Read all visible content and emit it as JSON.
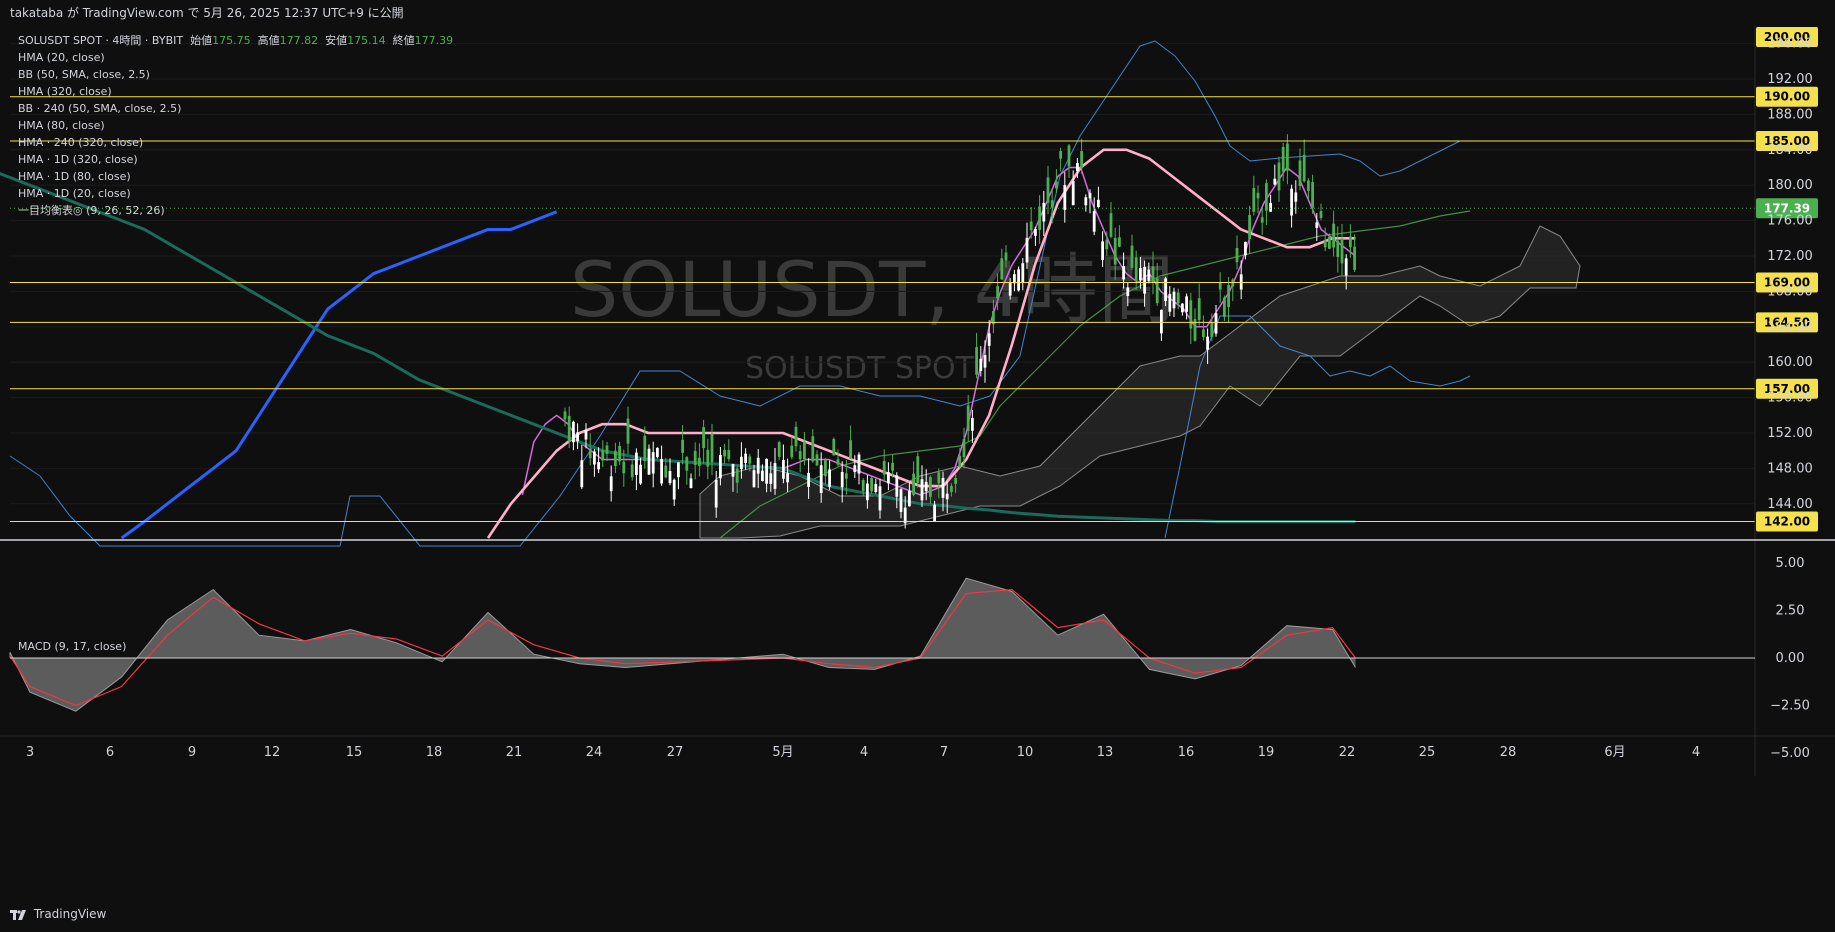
{
  "header": {
    "text": "takataba が TradingView.com で 5月 26, 2025 12:37 UTC+9 に公開"
  },
  "legend": {
    "symbol": "SOLUSDT SPOT · 4時間 · BYBIT",
    "open_label": "始値",
    "open": "175.75",
    "high_label": "高値",
    "high": "177.82",
    "low_label": "安値",
    "low": "175.14",
    "close_label": "終値",
    "close": "177.39",
    "indicators": [
      "HMA (20, close)",
      "BB (50, SMA, close, 2.5)",
      "HMA (320, close)",
      "BB · 240 (50, SMA, close, 2.5)",
      "HMA (80, close)",
      "HMA · 240 (320, close)",
      "HMA · 1D (320, close)",
      "HMA · 1D (80, close)",
      "HMA · 1D (20, close)",
      "一目均衡表◎ (9, 26, 52, 26)"
    ]
  },
  "watermark": {
    "main": "SOLUSDT, 4時間",
    "sub": "SOLUSDT SPOT"
  },
  "macd_label": "MACD (9, 17, close)",
  "footer": {
    "brand": "TradingView"
  },
  "colors": {
    "up": "#4caf50",
    "down": "#ffffff",
    "level": "#f5e14b",
    "bb": "#4a90e2",
    "hma20": "#d36be0",
    "hma80": "#ffb0c8",
    "hma320": "#2962ff",
    "hma_green": "#4caf50",
    "long_teal": "#1b6b5a",
    "cloud": "#808080",
    "macd_signal": "#f23645",
    "price_tag": "#4caf50"
  },
  "chart_data": [
    {
      "type": "line",
      "title": "SOLUSDT SPOT · 4時間 · BYBIT",
      "ylim": [
        140,
        200
      ],
      "x_ticks": [
        "3",
        "6",
        "9",
        "12",
        "15",
        "18",
        "21",
        "24",
        "27",
        "5月",
        "4",
        "7",
        "10",
        "13",
        "16",
        "19",
        "22",
        "25",
        "28",
        "6月",
        "4"
      ],
      "y_ticks": [
        "144.00",
        "148.00",
        "152.00",
        "156.00",
        "160.00",
        "164.00",
        "168.00",
        "172.00",
        "176.00",
        "180.00",
        "184.00",
        "188.00",
        "192.00",
        "196.00"
      ],
      "horizontal_levels": [
        200.0,
        190.0,
        185.0,
        169.0,
        164.5,
        157.0,
        142.0
      ],
      "level_labels": [
        "200.00",
        "190.00",
        "185.00",
        "169.00",
        "164.50",
        "157.00",
        "142.00"
      ],
      "last_price": 177.39,
      "last_price_label": "177.39",
      "series": [
        {
          "name": "HMA (20, close)",
          "x": [
            24.5,
            25,
            25.5,
            26,
            26.5,
            27,
            27.5,
            28,
            29,
            30,
            1,
            2,
            3,
            4,
            5,
            6,
            7,
            8,
            8.5,
            9,
            9.5,
            10,
            10.5,
            11,
            11.5,
            12,
            12.5,
            13,
            13.5,
            14,
            14.5,
            15,
            15.5,
            16,
            16.5,
            17,
            17.5,
            18,
            18.5,
            19,
            19.5,
            20,
            20.5,
            21,
            21.5,
            22,
            22.5,
            23,
            23.5,
            24,
            24.5,
            25,
            25.5,
            26
          ],
          "values": [
            145,
            151,
            153,
            154,
            153,
            151,
            150,
            149,
            149,
            149,
            148,
            149,
            149,
            148,
            147,
            146,
            145,
            146,
            148,
            152,
            158,
            164,
            168,
            171,
            173,
            175,
            178,
            181,
            182,
            182,
            178,
            175,
            172,
            170,
            169,
            170,
            168,
            167,
            166,
            164,
            164,
            166,
            168,
            171,
            175,
            178,
            180,
            182,
            181,
            178,
            175,
            174,
            173,
            172
          ]
        },
        {
          "name": "HMA (80, close)",
          "x": [
            23,
            24,
            25,
            26,
            27,
            28,
            29,
            30,
            1,
            2,
            3,
            4,
            5,
            6,
            7,
            8,
            9,
            10,
            11,
            12,
            13,
            14,
            15,
            16,
            17,
            18,
            19,
            20,
            21,
            22,
            23,
            24,
            25,
            26
          ],
          "values": [
            140,
            144,
            147,
            150,
            152,
            153,
            153,
            152,
            152,
            151,
            150,
            149,
            148,
            147,
            146,
            146,
            149,
            154,
            162,
            171,
            178,
            182,
            184,
            184,
            183,
            181,
            179,
            177,
            175,
            174,
            173,
            173,
            174,
            174
          ]
        },
        {
          "name": "HMA (320, close)",
          "x": [
            7,
            8,
            9,
            10,
            11,
            12,
            13,
            14,
            15,
            16,
            17,
            18,
            19,
            20,
            21,
            22,
            23,
            24,
            25,
            26
          ],
          "values": [
            140,
            142,
            144,
            146,
            148,
            150,
            154,
            158,
            162,
            166,
            168,
            170,
            171,
            172,
            173,
            174,
            175,
            175,
            176,
            177
          ]
        },
        {
          "name": "HMA · 240 (320, close)",
          "x": [
            -2,
            0,
            2,
            4,
            6,
            8,
            10,
            12,
            14,
            16,
            18,
            20,
            22,
            24,
            26,
            28,
            30,
            1,
            2,
            3,
            4,
            5,
            6,
            7,
            8,
            9,
            10,
            11,
            12,
            13,
            14,
            15,
            16,
            17,
            18,
            19,
            20,
            21,
            22,
            23,
            24,
            25,
            26
          ],
          "values": [
            185,
            183,
            181,
            179,
            177,
            175,
            172,
            169,
            166,
            163,
            161,
            158,
            156,
            154,
            152,
            150,
            149,
            148,
            147,
            146,
            145.5,
            145,
            144.5,
            144,
            143.8,
            143.5,
            143.3,
            143,
            142.8,
            142.6,
            142.5,
            142.4,
            142.3,
            142.2,
            142.1,
            142.1,
            142,
            142,
            142,
            142,
            142,
            142,
            142
          ]
        },
        {
          "name": "MACD",
          "x": [
            -1,
            1,
            3,
            5,
            7,
            9,
            11,
            13,
            15,
            17,
            19,
            21,
            23,
            25,
            27,
            29,
            1,
            3,
            5,
            7,
            9,
            11,
            13,
            15,
            17,
            19,
            21,
            23,
            25,
            26
          ],
          "values": [
            0,
            0.3,
            -1.8,
            -2.8,
            -1,
            2,
            3.6,
            1.2,
            0.9,
            1.5,
            0.8,
            -0.2,
            2.4,
            0.2,
            -0.3,
            -0.5,
            0.2,
            -0.5,
            -0.6,
            0.1,
            4.2,
            3.5,
            1.2,
            2.3,
            -0.6,
            -1.1,
            -0.4,
            1.7,
            1.5,
            -0.5
          ]
        },
        {
          "name": "MACD signal",
          "x": [
            -1,
            1,
            3,
            5,
            7,
            9,
            11,
            13,
            15,
            17,
            19,
            21,
            23,
            25,
            27,
            29,
            1,
            3,
            5,
            7,
            9,
            11,
            13,
            15,
            17,
            19,
            21,
            23,
            25,
            26
          ],
          "values": [
            0,
            0.1,
            -1.5,
            -2.5,
            -1.5,
            1.2,
            3.2,
            1.8,
            0.9,
            1.3,
            1.0,
            0.1,
            2.0,
            0.7,
            0,
            -0.3,
            0.0,
            -0.3,
            -0.5,
            0,
            3.4,
            3.6,
            1.6,
            2.0,
            0,
            -0.8,
            -0.5,
            1.2,
            1.6,
            0
          ]
        }
      ]
    },
    {
      "type": "area",
      "title": "MACD (9, 17, close)",
      "ylim": [
        -5,
        6.5
      ],
      "y_ticks": [
        "5.00",
        "2.50",
        "0.00",
        "−2.50",
        "−5.00"
      ]
    }
  ]
}
